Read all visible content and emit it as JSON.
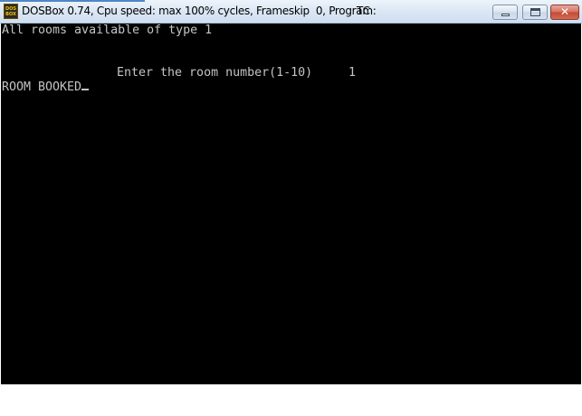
{
  "window": {
    "title": "DOSBox 0.74, Cpu speed: max 100% cycles, Frameskip  0, Program:",
    "program": "TC",
    "icon": "dosbox-icon",
    "icon_text_top": "DOS",
    "icon_text_bottom": "BOX",
    "controls": {
      "minimize": "minimize-icon",
      "maximize": "maximize-icon",
      "close": "close-icon",
      "close_glyph": "✕"
    }
  },
  "terminal": {
    "line1": "All rooms available of type 1",
    "prompt": "Enter the room number(1-10)",
    "prompt_value": "1",
    "status": "ROOM BOOKED",
    "colors": {
      "background": "#000000",
      "text": "#c4c4c4"
    }
  }
}
